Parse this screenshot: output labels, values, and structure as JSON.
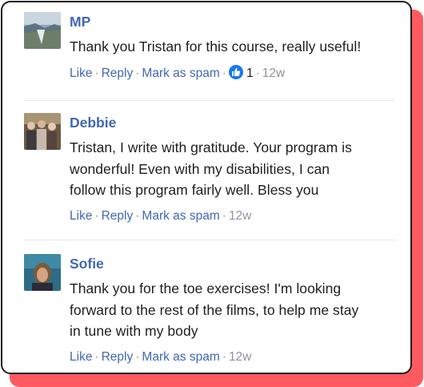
{
  "comments": [
    {
      "author": "MP",
      "text": "Thank you Tristan for this course, really useful!",
      "actions": {
        "like": "Like",
        "reply": "Reply",
        "spam": "Mark as spam"
      },
      "likes": "1",
      "age": "12w"
    },
    {
      "author": "Debbie",
      "text_lines": [
        "Tristan, I write with gratitude. Your program is",
        "wonderful! Even with my disabilities, I can",
        "follow this program fairly well. Bless you"
      ],
      "actions": {
        "like": "Like",
        "reply": "Reply",
        "spam": "Mark as spam"
      },
      "age": "12w"
    },
    {
      "author": "Sofie",
      "text_lines": [
        "Thank you for the toe exercises! I'm looking",
        "forward to the rest of the films, to help me stay",
        "in tune with my body"
      ],
      "actions": {
        "like": "Like",
        "reply": "Reply",
        "spam": "Mark as spam"
      },
      "age": "12w"
    }
  ],
  "separator": "·",
  "colors": {
    "link": "#4267b2",
    "muted": "#90949c",
    "accent_shadow": "#ff5a5f",
    "like_badge": "#1877f2"
  },
  "icons": {
    "like_badge": "thumbs-up-icon"
  }
}
